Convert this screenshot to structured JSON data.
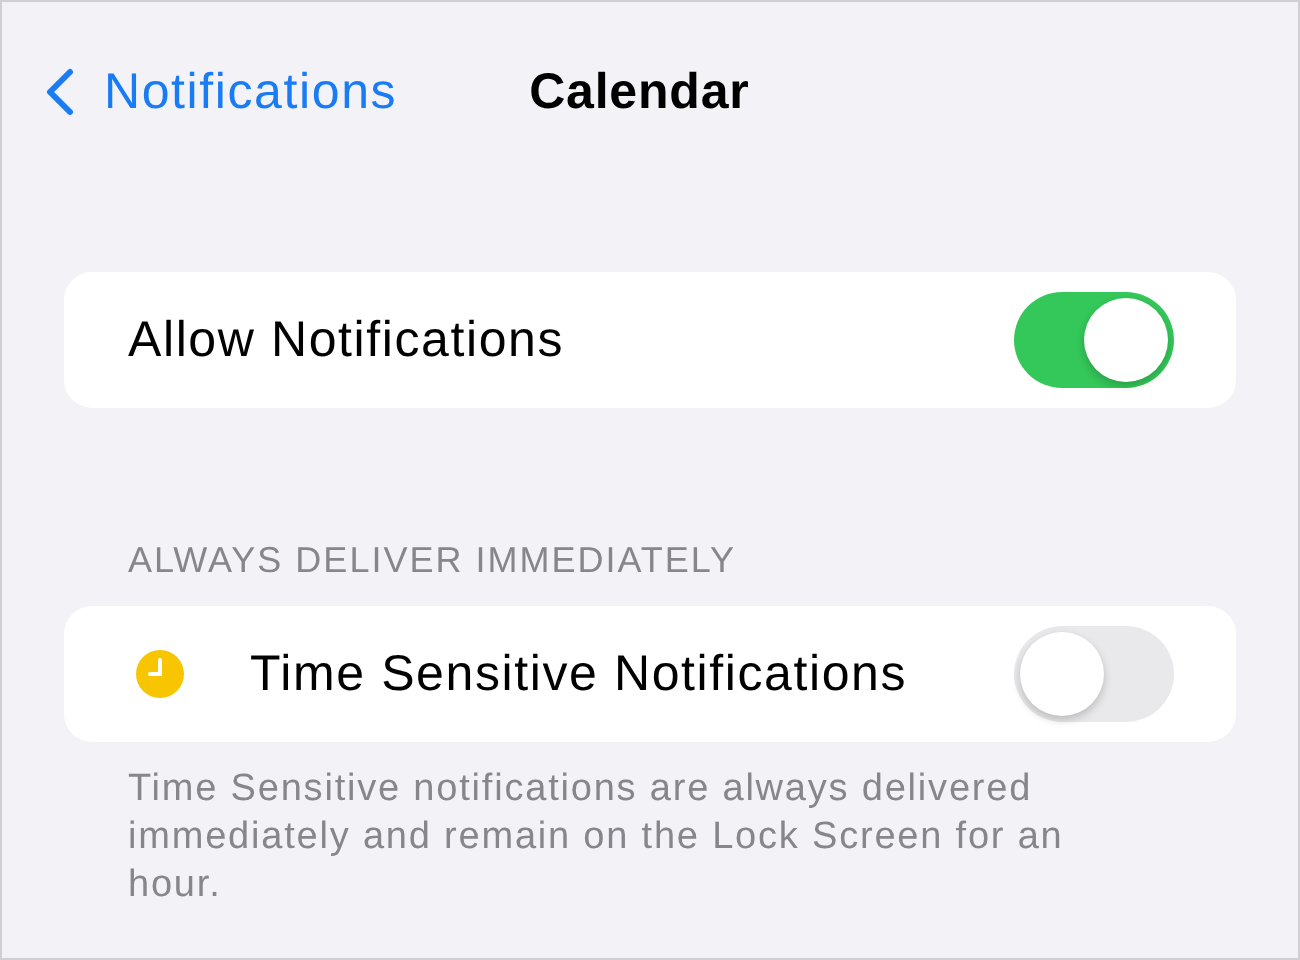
{
  "nav": {
    "back_label": "Notifications",
    "title": "Calendar"
  },
  "sections": [
    {
      "rows": [
        {
          "kind": "plain",
          "label": "Allow Notifications",
          "on": true
        }
      ]
    },
    {
      "header": "ALWAYS DELIVER IMMEDIATELY",
      "rows": [
        {
          "kind": "icon",
          "label": "Time Sensitive Notifications",
          "on": false
        }
      ],
      "footer": "Time Sensitive notifications are always delivered immediately and remain on the Lock Screen for an hour."
    }
  ]
}
